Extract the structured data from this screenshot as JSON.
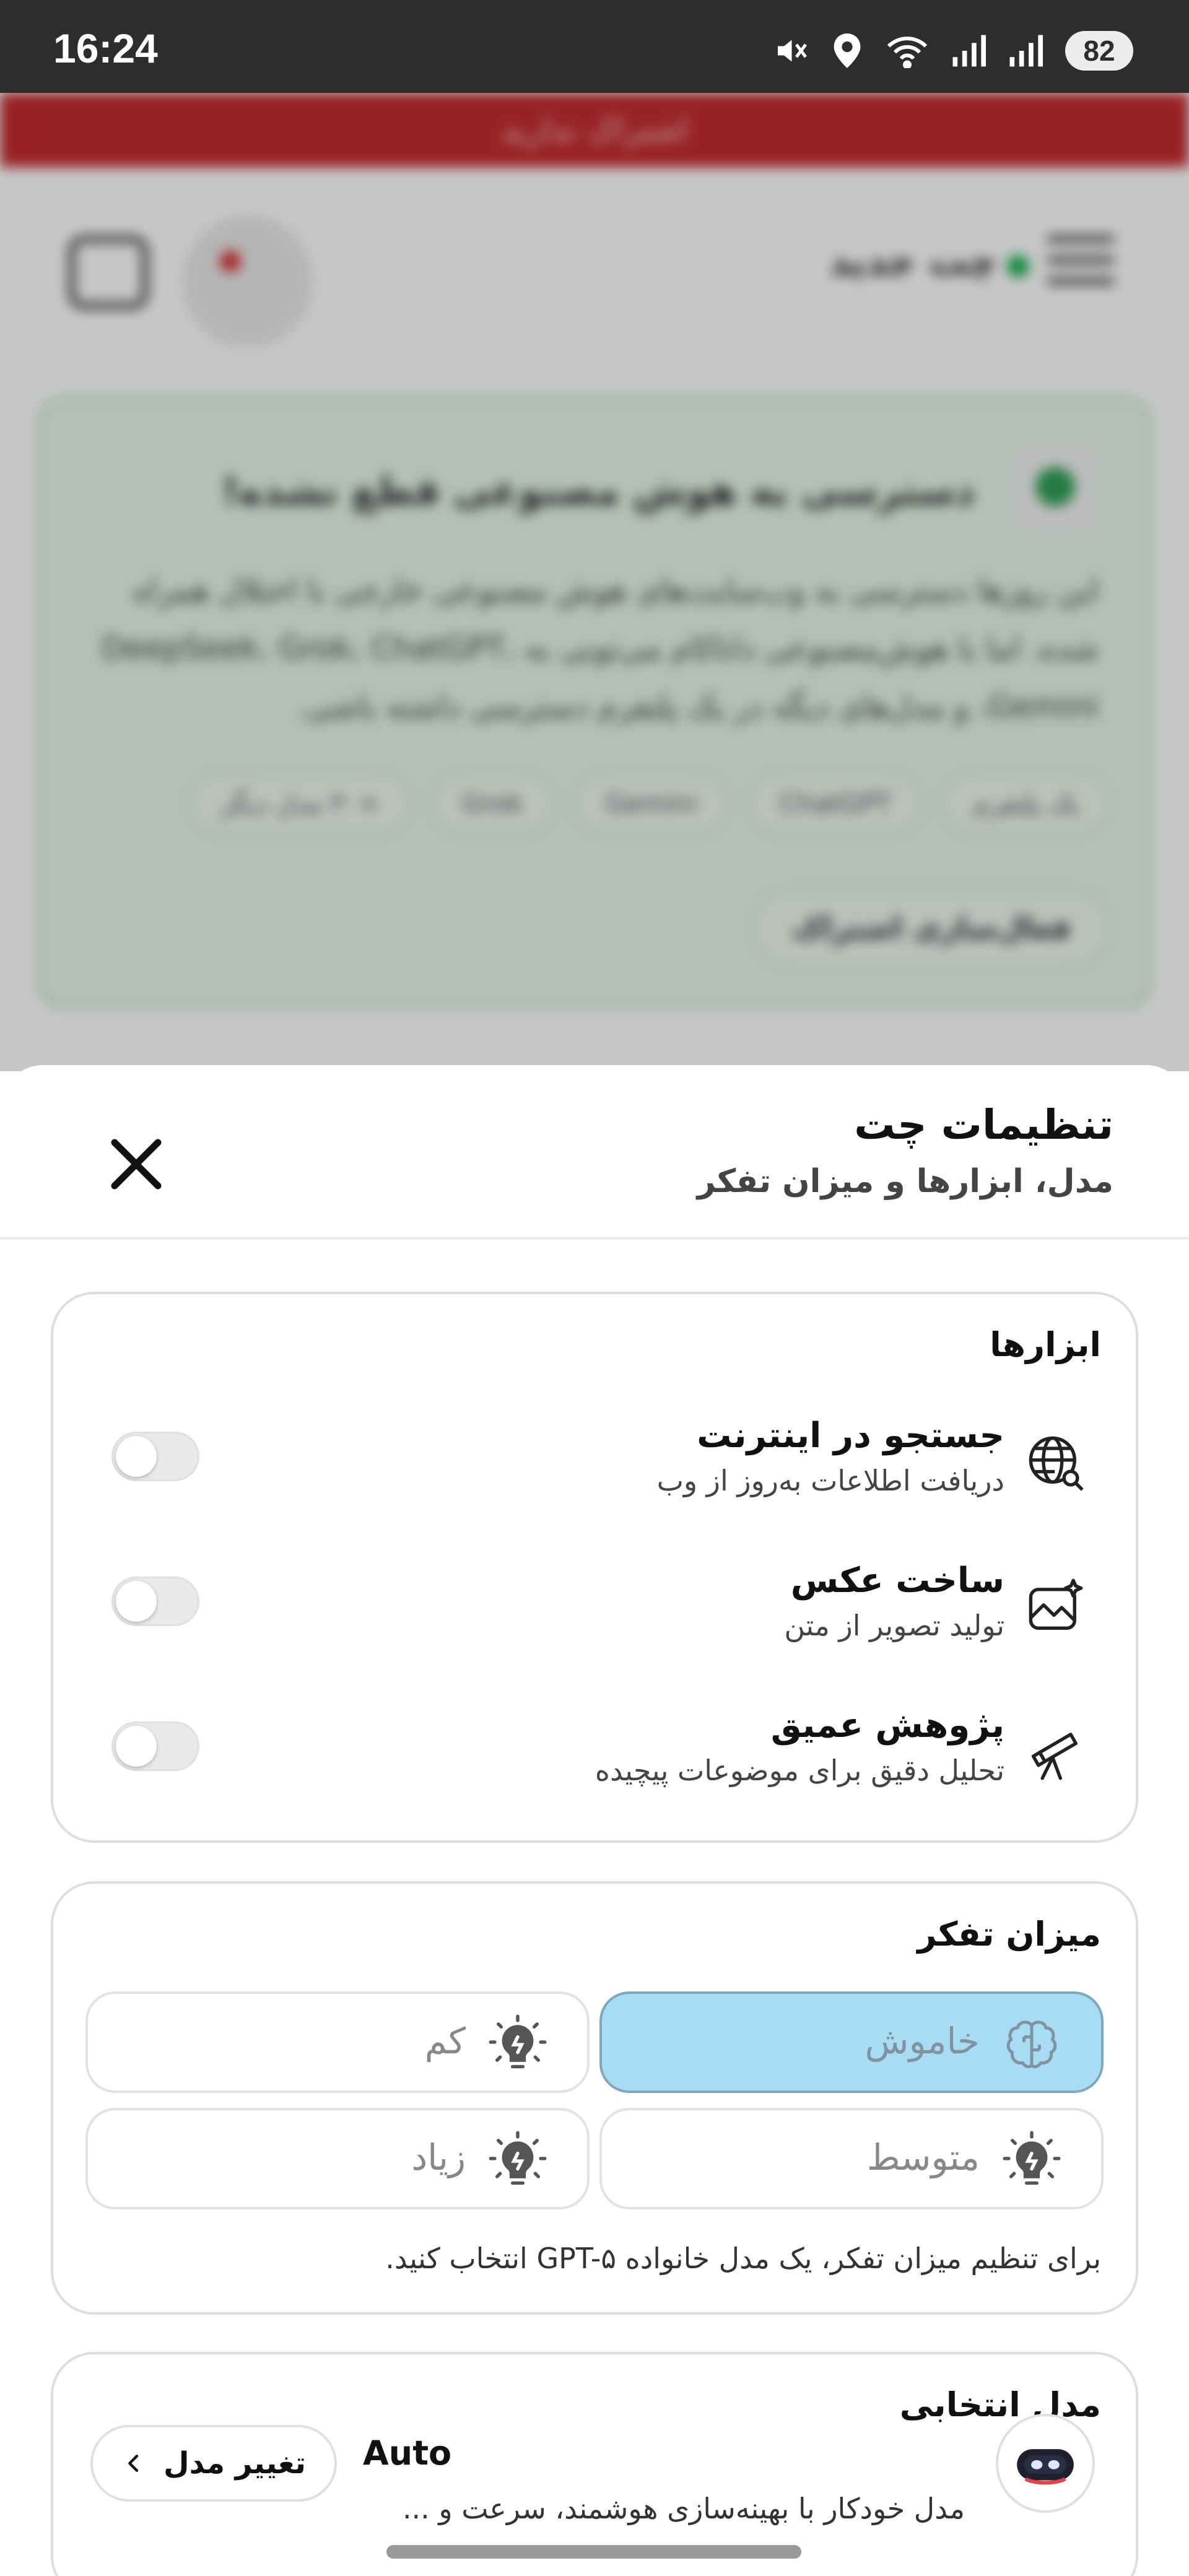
{
  "status_bar": {
    "time": "16:24",
    "battery": "82",
    "icons": [
      "mute-icon",
      "location-icon",
      "wifi-icon",
      "signal-icon",
      "signal-icon",
      "battery-icon"
    ]
  },
  "background": {
    "banner": "اشتراک ندارید",
    "header_title": "چت جدید",
    "card_title": "دسترسی به هوش مصنوعی قطع نشده!",
    "card_body": "این روزها دسترسی به وب‌سایت‌های هوش مصنوعی خارجی با اختلال همراه شده. اما با هوش‌مصنوعی داناکام می‌تونی به DeepSeek، Grok، ChatGPT، Gemini، و مدل‌های دیگه در یک پلتفرم دسترسی داشته باشی.",
    "tags": [
      "یک پلتفرم",
      "ChatGPT",
      "Gemini",
      "Grok",
      "+۳۰ مدل دیگر"
    ],
    "activate": "فعال‌سازی اشتراک"
  },
  "sheet": {
    "title": "تنظیمات چت",
    "subtitle": "مدل، ابزارها و میزان تفکر"
  },
  "tools": {
    "title": "ابزارها",
    "items": [
      {
        "name": "جستجو در اینترنت",
        "desc": "دریافت اطلاعات به‌روز از وب",
        "icon": "globe-search-icon",
        "enabled": false
      },
      {
        "name": "ساخت عکس",
        "desc": "تولید تصویر از متن",
        "icon": "image-sparkle-icon",
        "enabled": false
      },
      {
        "name": "پژوهش عمیق",
        "desc": "تحلیل دقیق برای موضوعات پیچیده",
        "icon": "telescope-icon",
        "enabled": false
      }
    ]
  },
  "thinking": {
    "title": "میزان تفکر",
    "options": [
      {
        "label": "خاموش",
        "icon": "brain-icon",
        "selected": true
      },
      {
        "label": "کم",
        "icon": "lightbulb-icon",
        "selected": false
      },
      {
        "label": "متوسط",
        "icon": "lightbulb-icon",
        "selected": false
      },
      {
        "label": "زیاد",
        "icon": "lightbulb-icon",
        "selected": false
      }
    ],
    "note": "برای تنظیم میزان تفکر، یک مدل خانواده GPT-۵ انتخاب کنید."
  },
  "model": {
    "title": "مدل انتخابی",
    "name": "Auto",
    "desc": "مدل خودکار با بهینه‌سازی هوشمند، سرعت و ...",
    "change_label": "تغییر مدل"
  },
  "colors": {
    "selected_thinking": "#a7dcf3",
    "banner": "#c32b2e",
    "status_bar": "#2d2d2d"
  }
}
